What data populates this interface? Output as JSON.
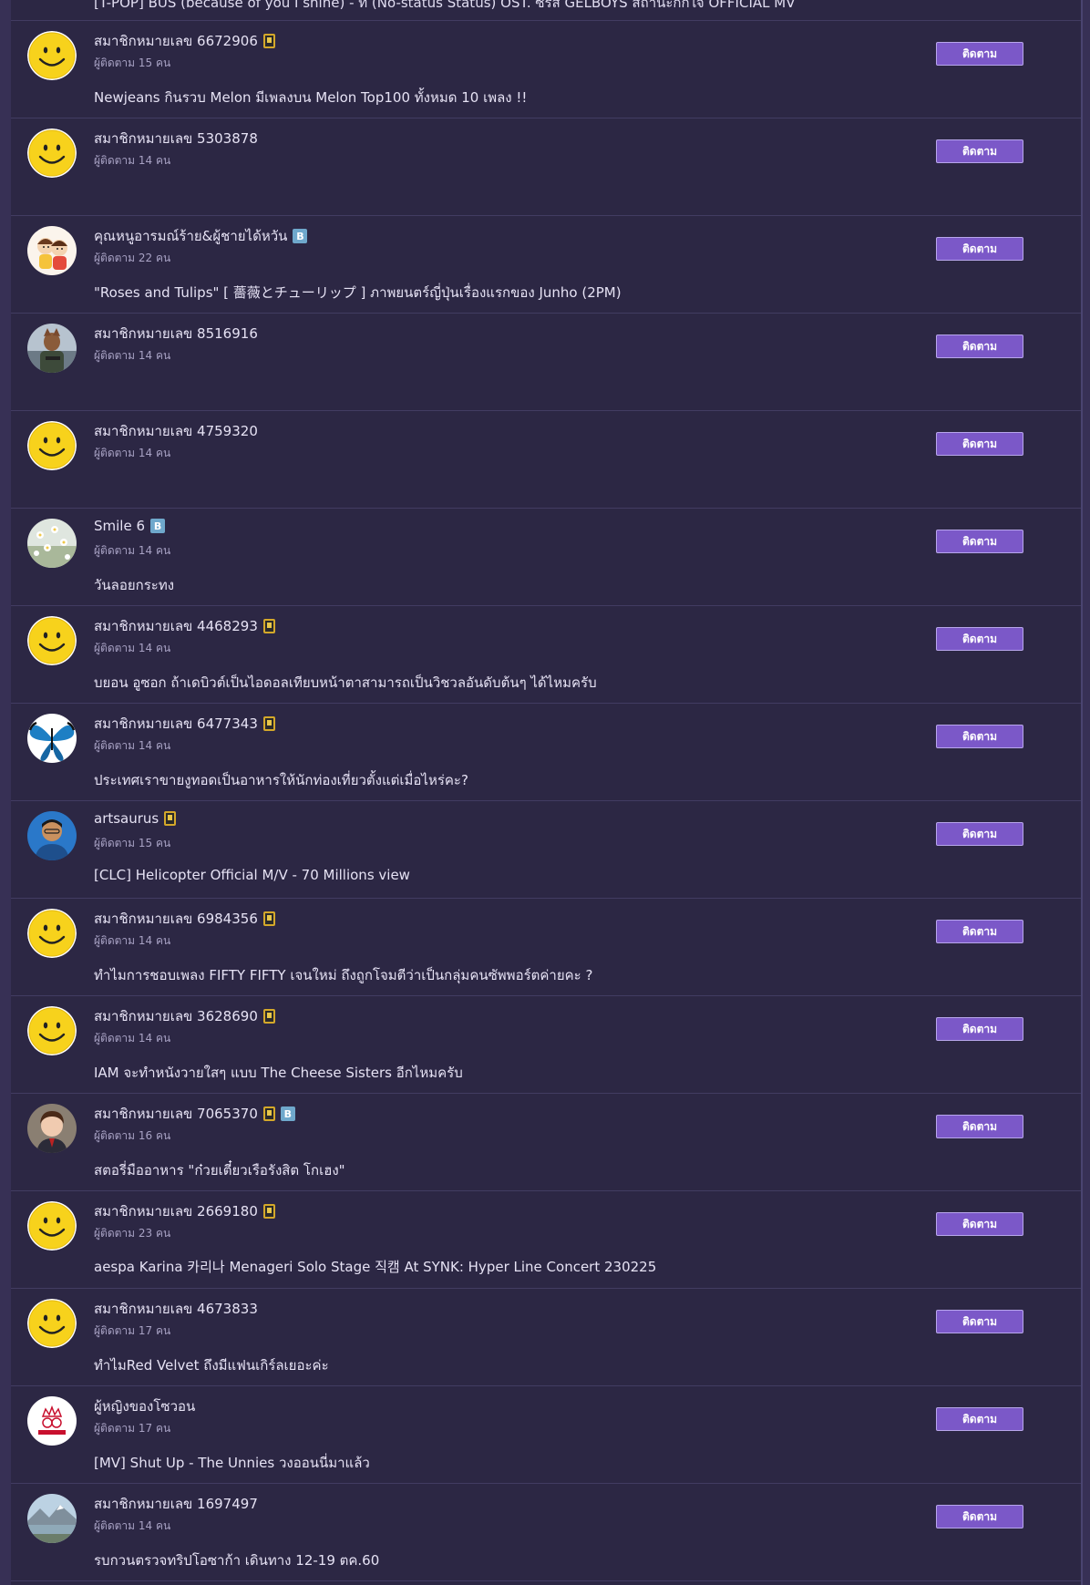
{
  "top_partial_title": "[T-POP] BUS (because of you I shine) - ที่ (No-status Status) OST. ซีรีส์ GELBOYS สถานะกั๊กใจ OFFICIAL MV",
  "follow_label": "ติดตาม",
  "members": [
    {
      "name": "สมาชิกหมายเลข 6672906",
      "badges": [
        "mobile"
      ],
      "followers": "ผู้ติดตาม 15 คน",
      "post": "Newjeans กินรวบ Melon มีเพลงบน Melon Top100 ทั้งหมด 10 เพลง !!",
      "avatar": "smiley"
    },
    {
      "name": "สมาชิกหมายเลข 5303878",
      "badges": [],
      "followers": "ผู้ติดตาม 14 คน",
      "post": "",
      "avatar": "smiley"
    },
    {
      "name": "คุณหนูอารมณ์ร้าย&ผู้ชายได้หวัน",
      "badges": [
        "blog"
      ],
      "followers": "ผู้ติดตาม 22 คน",
      "post": "\"Roses and Tulips\" [ 薔薇とチューリップ ] ภาพยนตร์ญี่ปุ่นเรื่องแรกของ Junho (2PM)",
      "avatar": "cartoon-kids"
    },
    {
      "name": "สมาชิกหมายเลข 8516916",
      "badges": [],
      "followers": "ผู้ติดตาม 14 คน",
      "post": "",
      "avatar": "photo-soldier"
    },
    {
      "name": "สมาชิกหมายเลข 4759320",
      "badges": [],
      "followers": "ผู้ติดตาม 14 คน",
      "post": "",
      "avatar": "smiley"
    },
    {
      "name": "Smile 6",
      "badges": [
        "blog"
      ],
      "followers": "ผู้ติดตาม 14 คน",
      "post": "วันลอยกระทง",
      "avatar": "photo-flowers"
    },
    {
      "name": "สมาชิกหมายเลข 4468293",
      "badges": [
        "mobile"
      ],
      "followers": "ผู้ติดตาม 14 คน",
      "post": "บยอน อูซอก ถ้าเดบิวต์เป็นไอดอลเทียบหน้าตาสามารถเป็นวิชวลอันดับต้นๆ ได้ไหมครับ",
      "avatar": "smiley"
    },
    {
      "name": "สมาชิกหมายเลข 6477343",
      "badges": [
        "mobile"
      ],
      "followers": "ผู้ติดตาม 14 คน",
      "post": "ประเทศเราขายงูทอดเป็นอาหารให้นักท่องเที่ยวตั้งแต่เมื่อไหร่คะ?",
      "avatar": "photo-butterfly"
    },
    {
      "name": "artsaurus",
      "badges": [
        "mobile"
      ],
      "followers": "ผู้ติดตาม 15 คน",
      "post": "[CLC] Helicopter Official M/V - 70 Millions view",
      "avatar": "photo-man"
    },
    {
      "name": "สมาชิกหมายเลข 6984356",
      "badges": [
        "mobile"
      ],
      "followers": "ผู้ติดตาม 14 คน",
      "post": "ทำไมการชอบเพลง FIFTY FIFTY เจนใหม่ ถึงถูกโจมตีว่าเป็นกลุ่มคนซัพพอร์ตค่ายคะ ?",
      "avatar": "smiley"
    },
    {
      "name": "สมาชิกหมายเลข 3628690",
      "badges": [
        "mobile"
      ],
      "followers": "ผู้ติดตาม 14 คน",
      "post": "IAM จะทำหนังวายใสๆ แบบ The Cheese Sisters อีกไหมครับ",
      "avatar": "smiley"
    },
    {
      "name": "สมาชิกหมายเลข 7065370",
      "badges": [
        "mobile",
        "blog"
      ],
      "followers": "ผู้ติดตาม 16 คน",
      "post": "สตอรี่มืออาหาร \"ก๋วยเตี๋ยวเรือรังสิต โกเฮง\"",
      "avatar": "photo-boy"
    },
    {
      "name": "สมาชิกหมายเลข 2669180",
      "badges": [
        "mobile"
      ],
      "followers": "ผู้ติดตาม 23 คน",
      "post": "aespa Karina 카리나 Menageri Solo Stage 직캠 At SYNK: Hyper Line Concert 230225",
      "avatar": "smiley"
    },
    {
      "name": "สมาชิกหมายเลข 4673833",
      "badges": [],
      "followers": "ผู้ติดตาม 17 คน",
      "post": "ทำไมRed Velvet ถึงมีแฟนเกิร์ลเยอะค่ะ",
      "avatar": "smiley"
    },
    {
      "name": "ผู้หญิงของโซวอน",
      "badges": [],
      "followers": "ผู้ติดตาม 17 คน",
      "post": "[MV] Shut Up - The Unnies วงออนนี่มาแล้ว",
      "avatar": "logo-crown"
    },
    {
      "name": "สมาชิกหมายเลข 1697497",
      "badges": [],
      "followers": "ผู้ติดตาม 14 คน",
      "post": "รบกวนตรวจทริปโอซาก้า เดินทาง 12-19 ตค.60",
      "avatar": "photo-landscape"
    }
  ]
}
